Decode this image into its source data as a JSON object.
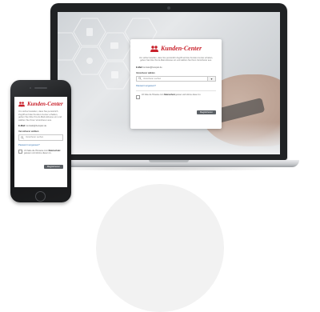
{
  "brand": {
    "name": "Kunden-Center",
    "logo_icon": "people-group-icon",
    "color": "#c8202a"
  },
  "login": {
    "intro": "Um sicherzustellen, dass Sie persönlich Zugriff auf das Kunden-Center erhalten, geben Sie bitte Ihre E-Mail-Adresse ein und wählen Sie Ihren Versicherer aus.",
    "email_label": "E-Mail:",
    "email_value": "kontakt@beispiel.de",
    "insurer_label": "Versicherer wählen",
    "insurer_placeholder": "Versicherer suchen",
    "select_arrow": "▾",
    "alt_login_link": "Passwort vergessen?",
    "consent_prefix": "Ich habe die Hinweise zum ",
    "consent_bold": "Datenschutz",
    "consent_suffix": " gelesen und stimme diesen zu.",
    "submit_label": "Registrieren"
  },
  "colors": {
    "button": "#5c6166",
    "link": "#2f6fb0"
  }
}
